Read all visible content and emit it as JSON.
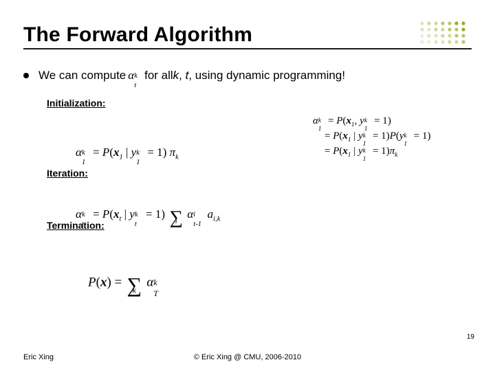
{
  "title": "The Forward Algorithm",
  "bullet": {
    "pre": "We can compute ",
    "alpha_base": "α",
    "alpha_sup": "k",
    "alpha_sub": "t",
    "post1": " for all ",
    "post2": ", using dynamic programming!",
    "k": "k",
    "t": "t"
  },
  "sections": {
    "init": "Initialization:",
    "iter": "Iteration:",
    "term": "Termination:"
  },
  "eq": {
    "alpha": "α",
    "pi": "π",
    "eq": " = ",
    "P": "P",
    "lp": "(",
    "rp": ")",
    "bar": " | ",
    "comma": ", ",
    "x": "x",
    "y": "y",
    "bx": "x",
    "eq1": " = 1",
    "sum": "∑",
    "a": "a",
    "dotprod": " ",
    "k": "k",
    "t": "t",
    "one": "1",
    "tm1": "t-1",
    "T": "T",
    "i": "i",
    "ik": "i,k"
  },
  "footer": {
    "left": "Eric Xing",
    "center": "© Eric Xing @ CMU, 2006-2010",
    "slide": "19"
  },
  "decoration": {
    "dot_colors": [
      "#94a933",
      "#b8c66a",
      "#d0d79a",
      "#e1e3c2",
      "#eceddb"
    ]
  }
}
